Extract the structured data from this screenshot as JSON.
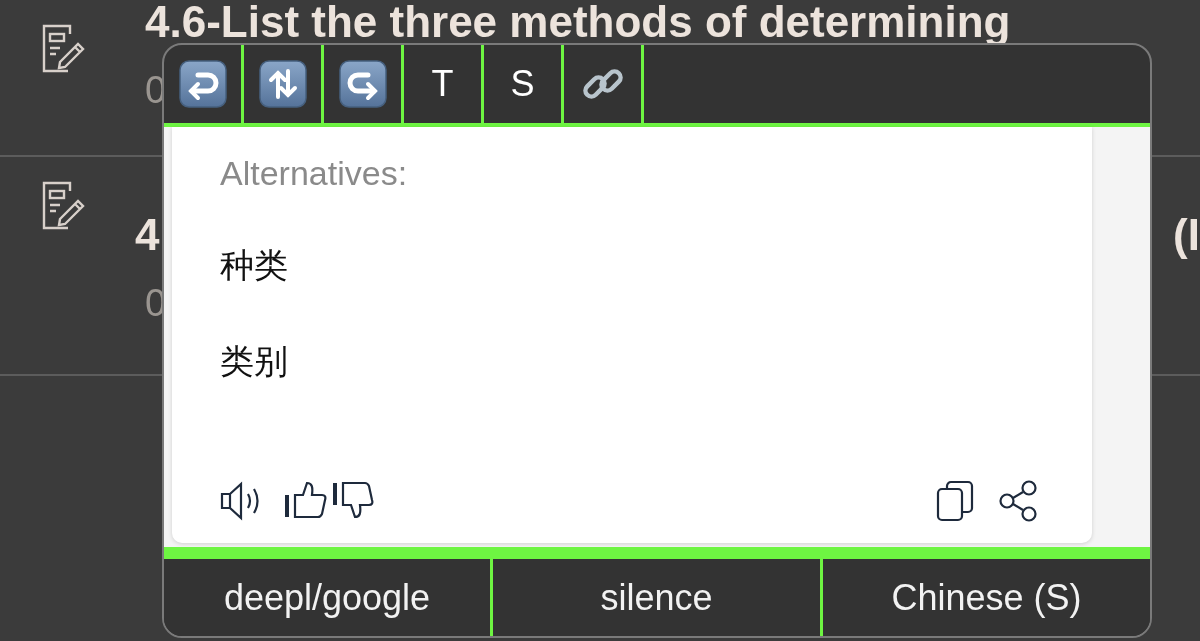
{
  "list": {
    "items": [
      {
        "title": "4.6-List the three methods of determining",
        "subtitle": "0"
      },
      {
        "title_start": "4",
        "title_end": "(I",
        "subtitle": "0"
      }
    ]
  },
  "popup": {
    "toolbar": [
      {
        "kind": "undo"
      },
      {
        "kind": "swap"
      },
      {
        "kind": "redo"
      },
      {
        "kind": "text",
        "label": "T"
      },
      {
        "kind": "text",
        "label": "S"
      },
      {
        "kind": "link"
      }
    ],
    "alternatives_label": "Alternatives:",
    "alternatives": [
      "种类",
      "类别"
    ],
    "actions_left": [
      {
        "kind": "speaker"
      },
      {
        "kind": "thumbs-up"
      },
      {
        "kind": "thumbs-down"
      }
    ],
    "actions_right": [
      {
        "kind": "copy"
      },
      {
        "kind": "share"
      }
    ],
    "bottom_buttons": [
      "deepl/google",
      "silence",
      "Chinese (S)"
    ]
  }
}
